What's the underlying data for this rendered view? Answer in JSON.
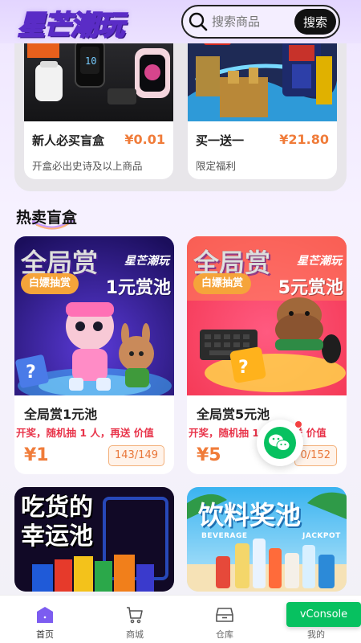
{
  "header": {
    "logo_text": "星芒潮玩",
    "search": {
      "placeholder": "搜索商品",
      "button_label": "搜索"
    }
  },
  "promos": [
    {
      "title": "新人必买盲盒",
      "price": "¥0.01",
      "desc": "开盒必出史诗及以上商品"
    },
    {
      "title": "买一送一",
      "price": "¥21.80",
      "desc": "限定福利"
    }
  ],
  "section": {
    "title": "热卖盲盒"
  },
  "pools": [
    {
      "img_title": "全局赏",
      "brand": "星芒潮玩",
      "tag": "白嫖抽赏",
      "amount": "1元赏池",
      "name": "全局赏1元池",
      "desc": "开奖，随机抽 1 人，再送 价值",
      "price": "¥1",
      "count": "143/149"
    },
    {
      "img_title": "全局赏",
      "brand": "星芒潮玩",
      "tag": "白嫖抽赏",
      "amount": "5元赏池",
      "name": "全局赏5元池",
      "desc": "开奖，随机抽 1 人，再送 价值",
      "price": "¥5",
      "count": "0/152"
    }
  ],
  "more_pools": [
    {
      "title_line1": "吃货的",
      "title_line2": "幸运池"
    },
    {
      "title": "饮料奖池",
      "sub_left": "BEVERAGE",
      "sub_right": "JACKPOT"
    }
  ],
  "tabbar": {
    "items": [
      {
        "label": "首页",
        "icon": "home-icon"
      },
      {
        "label": "商城",
        "icon": "cart-icon"
      },
      {
        "label": "仓库",
        "icon": "warehouse-icon"
      },
      {
        "label": "我的",
        "icon": "profile-icon"
      }
    ]
  },
  "vconsole": {
    "label": "vConsole"
  },
  "colors": {
    "accent": "#f07c3a",
    "tab_active": "#7c5cf0",
    "wechat": "#07c160"
  }
}
